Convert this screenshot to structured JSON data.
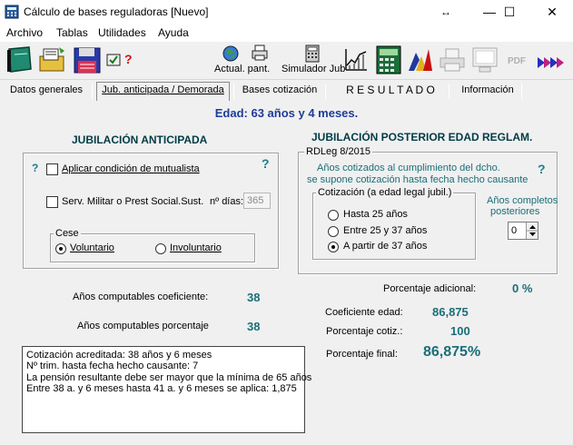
{
  "window": {
    "title": "Cálculo de bases reguladoras   [Nuevo]",
    "controls": {
      "restore": "↔",
      "minimize": "—",
      "maximize": "☐",
      "close": "✕"
    }
  },
  "menu": [
    "Archivo",
    "Tablas",
    "Utilidades",
    "Ayuda"
  ],
  "toolbar": {
    "actualizar_label": "Actual. pant.",
    "simulador_label": "Simulador Jub",
    "pdf_label": "PDF",
    "help_mark": "?"
  },
  "tabs": [
    "Datos generales",
    "Jub. anticipada  / Demorada",
    "Bases cotización",
    "R E S U L T A D O",
    "Información"
  ],
  "edad": "Edad: 63 años y 4 meses.",
  "anticipada": {
    "title": "JUBILACIÓN ANTICIPADA",
    "help": "?",
    "help2": "?",
    "mutualista_label": "Aplicar condición de mutualista",
    "servicio_label": "Serv. Militar o Prest Social.Sust.",
    "dias_label": "nº días:",
    "dias_value": "365",
    "cese_label": "Cese",
    "voluntario_label": "Voluntario",
    "involuntario_label": "Involuntario"
  },
  "posterior": {
    "title": "JUBILACIÓN POSTERIOR EDAD REGLAM.",
    "group_label": "RDLeg 8/2015",
    "line1": "Años cotizados al cumplimiento del dcho.",
    "line2": "se supone cotización hasta fecha hecho causante",
    "help": "?",
    "cotizacion_label": "Cotización  (a edad legal jubil.)",
    "opt1": "Hasta 25 años",
    "opt2": "Entre 25 y 37 años",
    "opt3": "A partir de 37 años",
    "completos_label1": "Años completos",
    "completos_label2": "posteriores",
    "completos_value": "0"
  },
  "resultados": {
    "coef_label": "Años computables coeficiente:",
    "coef_value": "38",
    "porc_label": "Años computables porcentaje",
    "porc_value": "38",
    "adicional_label": "Porcentaje adicional:",
    "adicional_value": "0  %",
    "coeficiente_edad_label": "Coeficiente edad:",
    "coeficiente_edad_value": "86,875",
    "porcentaje_cotiz_label": "Porcentaje cotiz.:",
    "porcentaje_cotiz_value": "100",
    "porcentaje_final_label": "Porcentaje final:",
    "porcentaje_final_value": "86,875%"
  },
  "notes": [
    "Cotización acreditada:  38 años y 6 meses",
    "Nº trim. hasta fecha hecho causante:  7",
    "La pensión resultante debe ser mayor que la mínima de 65 años",
    "Entre 38 a. y 6 meses hasta 41 a. y 6 meses  se aplica: 1,875"
  ]
}
